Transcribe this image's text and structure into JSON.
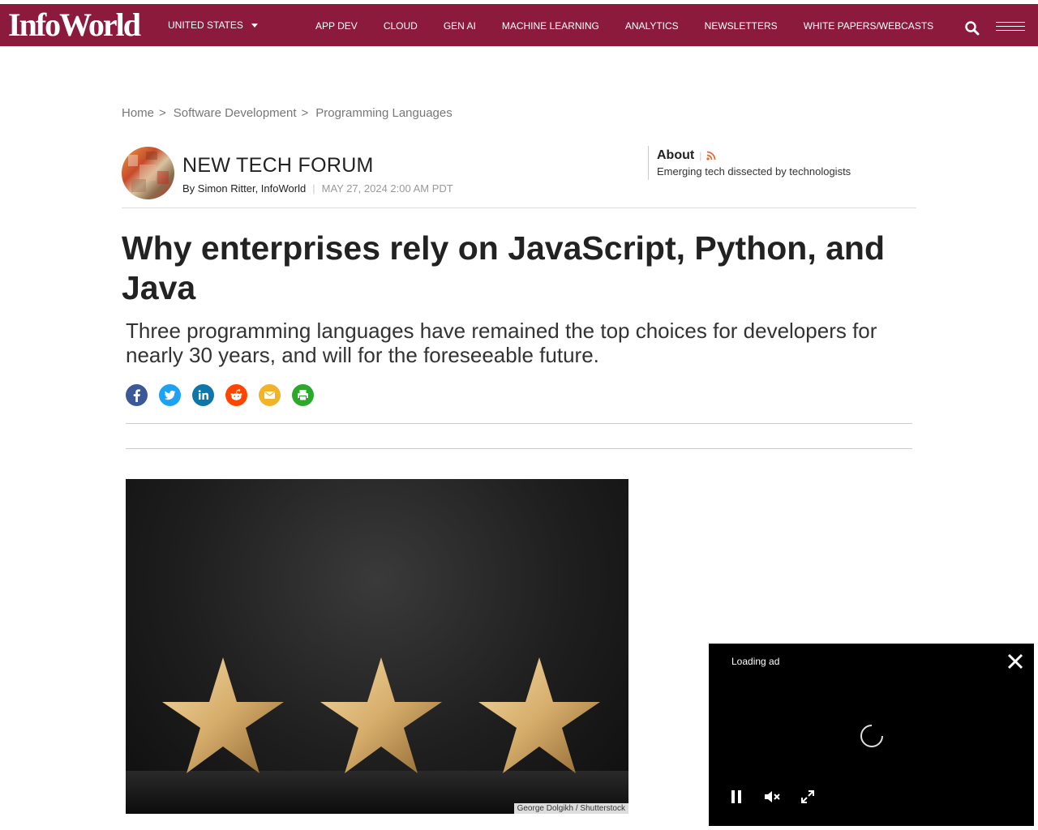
{
  "header": {
    "logo": "InfoWorld",
    "region": "UNITED STATES",
    "nav": [
      "APP DEV",
      "CLOUD",
      "GEN AI",
      "MACHINE LEARNING",
      "ANALYTICS",
      "NEWSLETTERS",
      "WHITE PAPERS/WEBCASTS"
    ],
    "brand_color": "#8b1a3c"
  },
  "breadcrumb": [
    "Home",
    "Software Development",
    "Programming Languages"
  ],
  "breadcrumb_sep": ">",
  "column": {
    "name": "NEW TECH FORUM",
    "byline": "By Simon Ritter, InfoWorld",
    "date": "MAY 27, 2024 2:00 AM PDT",
    "about_label": "About",
    "about_desc": "Emerging tech dissected by technologists"
  },
  "article": {
    "title": "Why enterprises rely on JavaScript, Python, and Java",
    "dek": "Three programming languages have remained the top choices for developers for nearly 30 years, and will for the foreseeable future.",
    "image_credit": "George Dolgikh / Shutterstock"
  },
  "share": [
    "facebook-icon",
    "twitter-icon",
    "linkedin-icon",
    "reddit-icon",
    "email-icon",
    "print-icon"
  ],
  "ad": {
    "status": "Loading ad"
  }
}
